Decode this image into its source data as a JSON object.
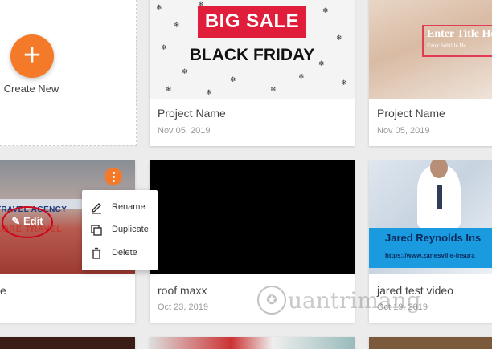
{
  "create": {
    "label": "Create New",
    "plus": "+"
  },
  "projects": [
    {
      "title": "Project Name",
      "date": "Nov 05, 2019",
      "thumb": {
        "line1": "BIG SALE",
        "line2": "BLACK FRIDAY"
      }
    },
    {
      "title": "Project Name",
      "date": "Nov 05, 2019",
      "thumb": {
        "title": "Enter Title He",
        "subtitle": "Enter Subtitle He"
      }
    },
    {
      "title": "e",
      "date": "",
      "thumb": {
        "line1": "TRAVEL AGENCY",
        "line2": "LORE TRAVEL"
      }
    },
    {
      "title": "roof maxx",
      "date": "Oct 23, 2019",
      "thumb": {}
    },
    {
      "title": "jared test video",
      "date": "Oct 19, 2019",
      "thumb": {
        "name": "Jared Reynolds Ins",
        "url": "https://www.zanesville-insura"
      }
    }
  ],
  "edit": {
    "label": "Edit"
  },
  "menu": {
    "items": [
      {
        "label": "Rename",
        "icon": "pencil-icon"
      },
      {
        "label": "Duplicate",
        "icon": "duplicate-icon"
      },
      {
        "label": "Delete",
        "icon": "trash-icon"
      }
    ]
  },
  "watermark": {
    "text": "uantrimang"
  },
  "colors": {
    "accent": "#f47a2a",
    "sale_red": "#e01e3c",
    "highlight_ring": "#d0021b",
    "banner_blue": "#1a9be0"
  }
}
